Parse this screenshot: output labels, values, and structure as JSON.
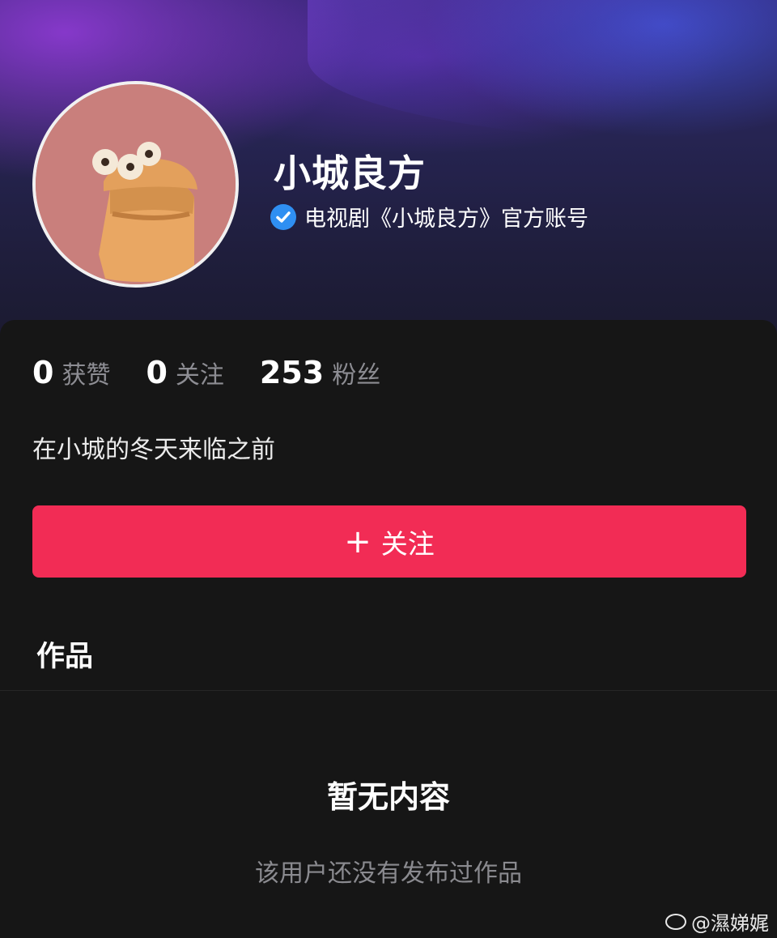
{
  "profile": {
    "name": "小城良方",
    "verified_text": "电视剧《小城良方》官方账号",
    "bio": "在小城的冬天来临之前"
  },
  "stats": [
    {
      "value": "0",
      "label": "获赞"
    },
    {
      "value": "0",
      "label": "关注"
    },
    {
      "value": "253",
      "label": "粉丝"
    }
  ],
  "actions": {
    "follow_plus": "+",
    "follow_label": "关注"
  },
  "tabs": {
    "works": "作品"
  },
  "empty_state": {
    "title": "暂无内容",
    "subtitle": "该用户还没有发布过作品"
  },
  "watermark": {
    "text": "@濕娣娓"
  },
  "colors": {
    "accent": "#f22c55",
    "verify": "#2f8ff2",
    "background": "#161616"
  },
  "icons": [
    "verified-check-icon",
    "plus-icon",
    "weibo-logo-icon"
  ]
}
